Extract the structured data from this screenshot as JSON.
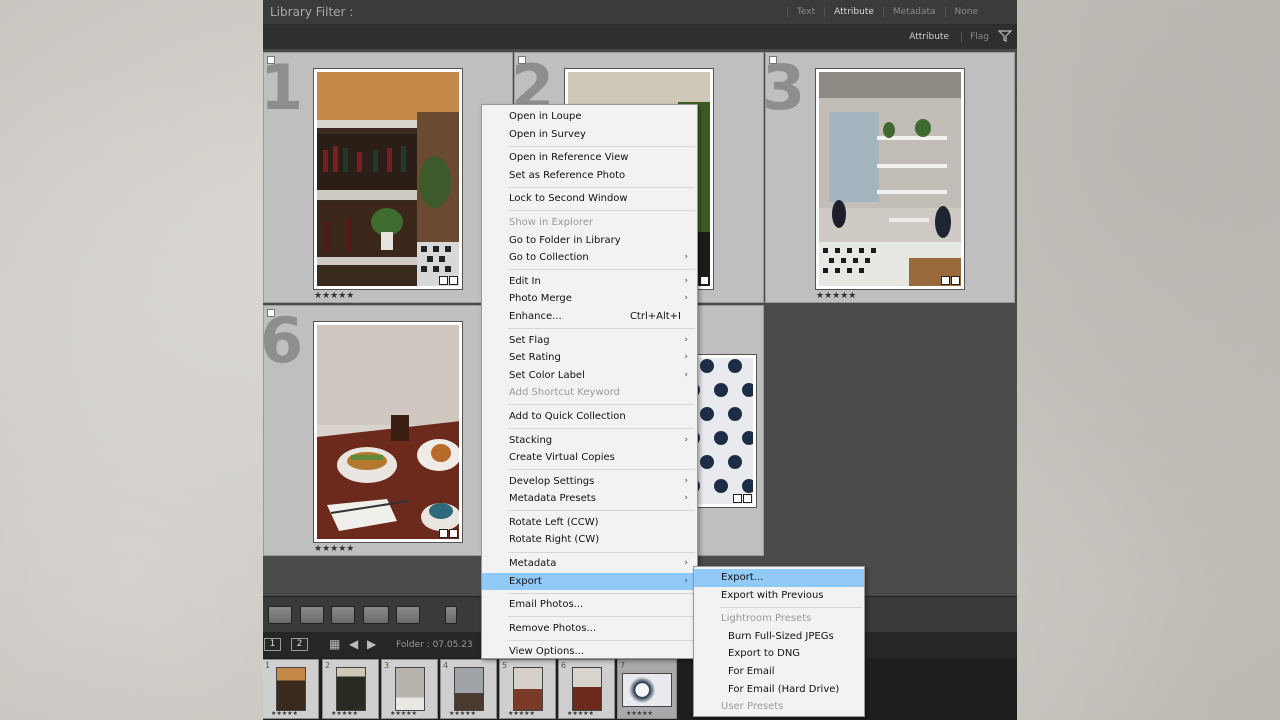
{
  "filter_bar": {
    "title": "Library Filter :",
    "tabs": [
      "Text",
      "Attribute",
      "Metadata",
      "None"
    ],
    "active_tab": "Attribute"
  },
  "attribute_bar": {
    "label": "Attribute",
    "flag_label": "Flag"
  },
  "grid": {
    "cells": [
      {
        "number": "1",
        "stars": "★★★★★",
        "photo": "wine-bar-shelves"
      },
      {
        "number": "2",
        "stars": "",
        "photo": "cafe-interior-dark"
      },
      {
        "number": "3",
        "stars": "★★★★★",
        "photo": "cafe-brick-wall"
      },
      {
        "number": "6",
        "stars": "★★★★★",
        "photo": "sandwich-and-coffee"
      },
      {
        "number": "",
        "stars": "",
        "photo": "black-white-tiles"
      }
    ]
  },
  "filmstrip_bar": {
    "screen_1": "1",
    "screen_2": "2",
    "folder": "Folder : 07.05.23"
  },
  "filmstrip": {
    "thumbs": [
      {
        "num": "1",
        "stars": "★★★★★"
      },
      {
        "num": "2",
        "stars": "★★★★★"
      },
      {
        "num": "3",
        "stars": "★★★★★"
      },
      {
        "num": "4",
        "stars": "★★★★★"
      },
      {
        "num": "5",
        "stars": "★★★★★"
      },
      {
        "num": "6",
        "stars": "★★★★★"
      },
      {
        "num": "7",
        "stars": "★★★★★"
      }
    ]
  },
  "context_menu": {
    "items": [
      {
        "label": "Open in Loupe"
      },
      {
        "label": "Open in Survey"
      },
      {
        "sep": true
      },
      {
        "label": "Open in Reference View"
      },
      {
        "label": "Set as Reference Photo"
      },
      {
        "sep": true
      },
      {
        "label": "Lock to Second Window"
      },
      {
        "sep": true
      },
      {
        "label": "Show in Explorer",
        "disabled": true
      },
      {
        "label": "Go to Folder in Library"
      },
      {
        "label": "Go to Collection",
        "submenu": true
      },
      {
        "sep": true
      },
      {
        "label": "Edit In",
        "submenu": true
      },
      {
        "label": "Photo Merge",
        "submenu": true
      },
      {
        "label": "Enhance...",
        "shortcut": "Ctrl+Alt+I"
      },
      {
        "sep": true
      },
      {
        "label": "Set Flag",
        "submenu": true
      },
      {
        "label": "Set Rating",
        "submenu": true
      },
      {
        "label": "Set Color Label",
        "submenu": true
      },
      {
        "label": "Add Shortcut Keyword",
        "disabled": true
      },
      {
        "sep": true
      },
      {
        "label": "Add to Quick Collection"
      },
      {
        "sep": true
      },
      {
        "label": "Stacking",
        "submenu": true
      },
      {
        "label": "Create Virtual Copies"
      },
      {
        "sep": true
      },
      {
        "label": "Develop Settings",
        "submenu": true
      },
      {
        "label": "Metadata Presets",
        "submenu": true
      },
      {
        "sep": true
      },
      {
        "label": "Rotate Left (CCW)"
      },
      {
        "label": "Rotate Right (CW)"
      },
      {
        "sep": true
      },
      {
        "label": "Metadata",
        "submenu": true
      },
      {
        "label": "Export",
        "submenu": true,
        "highlighted": true
      },
      {
        "sep": true
      },
      {
        "label": "Email Photos..."
      },
      {
        "sep": true
      },
      {
        "label": "Remove Photos..."
      },
      {
        "sep": true
      },
      {
        "label": "View Options..."
      }
    ]
  },
  "export_submenu": {
    "items": [
      {
        "label": "Export...",
        "highlighted": true
      },
      {
        "label": "Export with Previous"
      },
      {
        "sep": true
      },
      {
        "label": "Lightroom Presets",
        "disabled": true
      },
      {
        "label": "Burn Full-Sized JPEGs",
        "preset": true
      },
      {
        "label": "Export to DNG",
        "preset": true
      },
      {
        "label": "For Email",
        "preset": true
      },
      {
        "label": "For Email (Hard Drive)",
        "preset": true
      },
      {
        "label": "User Presets",
        "disabled": true
      }
    ]
  },
  "colors": {
    "menu_highlight": "#91c9f7",
    "cell_background": "#bfbfbf",
    "panel_dark": "#3b3b3b"
  }
}
